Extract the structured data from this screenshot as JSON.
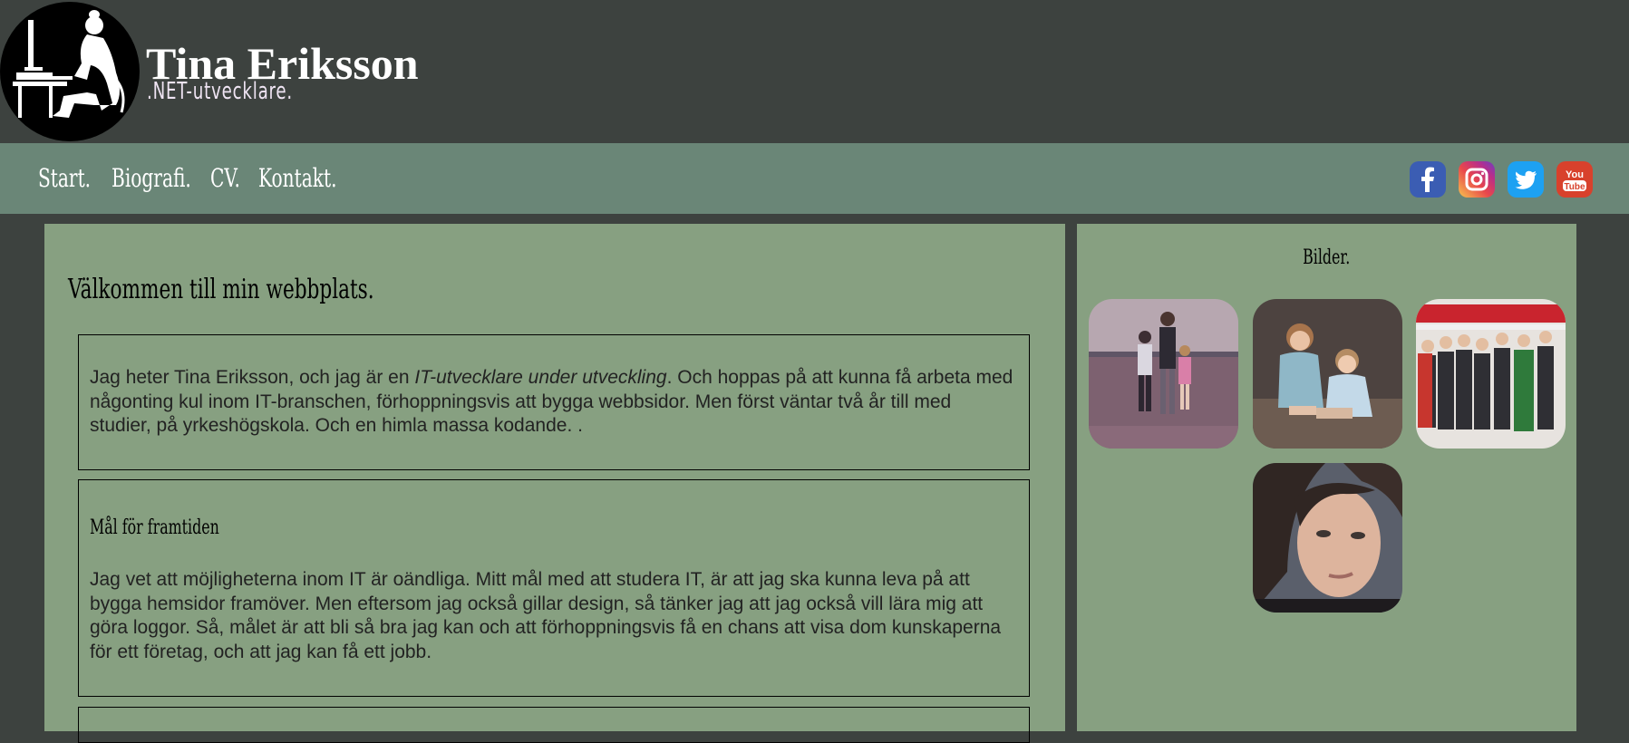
{
  "header": {
    "title": "Tina Eriksson",
    "subtitle": ".NET-utvecklare."
  },
  "nav": {
    "items": [
      {
        "label": "Start."
      },
      {
        "label": "Biografi."
      },
      {
        "label": "CV."
      },
      {
        "label": "Kontakt."
      }
    ]
  },
  "social": {
    "facebook": "facebook-icon",
    "instagram": "instagram-icon",
    "twitter": "twitter-icon",
    "youtube": "youtube-icon",
    "youtube_label_1": "You",
    "youtube_label_2": "Tube"
  },
  "main": {
    "welcome": "Välkommen till min webbplats.",
    "intro": {
      "before": "Jag heter Tina Eriksson, och jag är en ",
      "emphasis": "IT-utvecklare under utveckling",
      "after": ". Och hoppas på att kunna få arbeta med någonting kul inom IT-branschen, förhoppningsvis att bygga webbsidor. Men först väntar två år till med studier, på yrkeshögskola. Och en himla massa kodande. ."
    },
    "goals": {
      "heading": "Mål för framtiden",
      "text": "Jag vet att möjligheterna inom IT är oändliga. Mitt mål med att studera IT, är att jag ska kunna leva på att bygga hemsidor framöver. Men eftersom jag också gillar design, så tänker jag att jag också vill lära mig att göra loggor. Så, målet är att bli så bra jag kan och att förhoppningsvis få en chans att visa dom kunskaperna för ett företag, och att jag kan få ett jobb."
    }
  },
  "sidebar": {
    "title": "Bilder."
  },
  "colors": {
    "background": "#3d423f",
    "nav": "#6a8677",
    "panel": "#87a081"
  }
}
